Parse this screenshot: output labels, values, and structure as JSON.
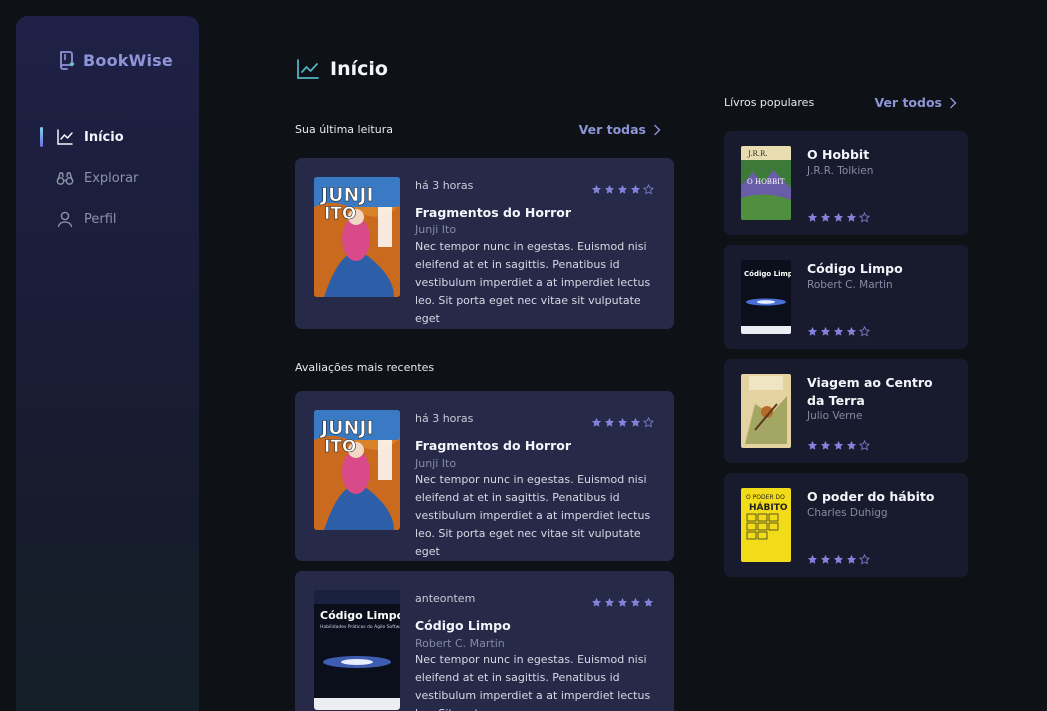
{
  "app": {
    "name": "BookWise"
  },
  "sidebar": {
    "items": [
      {
        "label": "Início",
        "icon": "chart-line-icon",
        "active": true
      },
      {
        "label": "Explorar",
        "icon": "binoculars-icon",
        "active": false
      },
      {
        "label": "Perfil",
        "icon": "user-icon",
        "active": false
      }
    ]
  },
  "page": {
    "title": "Início"
  },
  "last_reading": {
    "label": "Sua última leitura",
    "link": "Ver todas",
    "card": {
      "time": "há 3 horas",
      "rating": 4,
      "title": "Fragmentos do Horror",
      "author": "Junji Ito",
      "description": "Nec tempor nunc in egestas. Euismod nisi eleifend at et in sagittis. Penatibus id vestibulum imperdiet a at imperdiet lectus leo. Sit porta eget nec vitae sit vulputate eget",
      "cover_text": "JUNJI ITO"
    }
  },
  "recent_reviews": {
    "label": "Avaliações mais recentes",
    "cards": [
      {
        "time": "há 3 horas",
        "rating": 4,
        "title": "Fragmentos do Horror",
        "author": "Junji Ito",
        "description": "Nec tempor nunc in egestas. Euismod nisi eleifend at et in sagittis. Penatibus id vestibulum imperdiet a at imperdiet lectus leo. Sit porta eget nec vitae sit vulputate eget",
        "cover_text": "JUNJI ITO"
      },
      {
        "time": "anteontem",
        "rating": 5,
        "title": "Código Limpo",
        "author": "Robert C. Martin",
        "description": "Nec tempor nunc in egestas. Euismod nisi eleifend at et in sagittis. Penatibus id vestibulum imperdiet a at imperdiet lectus leo. Sit porta",
        "cover_text": "Código Limpo"
      }
    ]
  },
  "popular": {
    "label": "Lívros populares",
    "link": "Ver todos",
    "books": [
      {
        "title": "O Hobbit",
        "author": "J.R.R. Tolkien",
        "rating": 4
      },
      {
        "title": "Código Limpo",
        "author": "Robert C. Martin",
        "rating": 4
      },
      {
        "title": "Viagem ao Centro da Terra",
        "author": "Julio Verne",
        "rating": 4
      },
      {
        "title": "O poder do hábito",
        "author": "Charles Duhigg",
        "rating": 4
      }
    ]
  },
  "colors": {
    "accent": "#8d95d8",
    "star": "#8381d9",
    "card": "#262a48",
    "pop_card": "#181b2d",
    "background": "#0e1116"
  }
}
